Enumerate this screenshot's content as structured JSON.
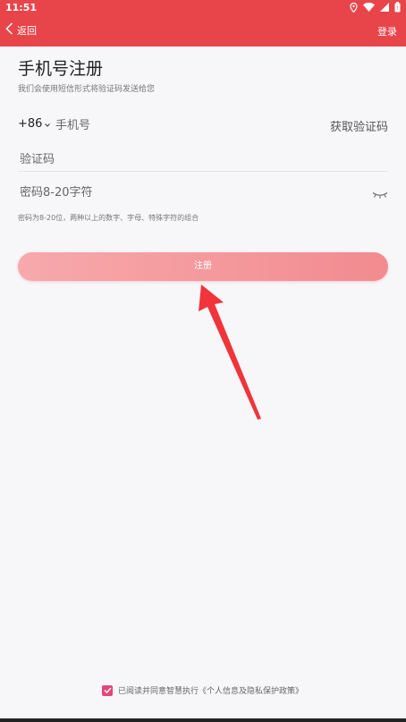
{
  "status_bar": {
    "time": "11:51",
    "icons": [
      "location-icon",
      "wifi-icon",
      "signal-icon",
      "battery-icon"
    ]
  },
  "nav": {
    "back_label": "返回",
    "login_label": "登录",
    "background": "#e8454a"
  },
  "form": {
    "title": "手机号注册",
    "subtitle": "我们会使用短信形式将验证码发送给您",
    "country_code": "+86",
    "phone_placeholder": "手机号",
    "get_code_label": "获取验证码",
    "code_placeholder": "验证码",
    "password_placeholder": "密码8-20字符",
    "password_hint": "密码为8-20位，两种以上的数字、字母、特殊字符的组合",
    "register_label": "注册"
  },
  "agreement": {
    "checked": true,
    "text": "已阅读并同意智慧执行《个人信息及隐私保护政策》",
    "accent": "#e6457a"
  }
}
